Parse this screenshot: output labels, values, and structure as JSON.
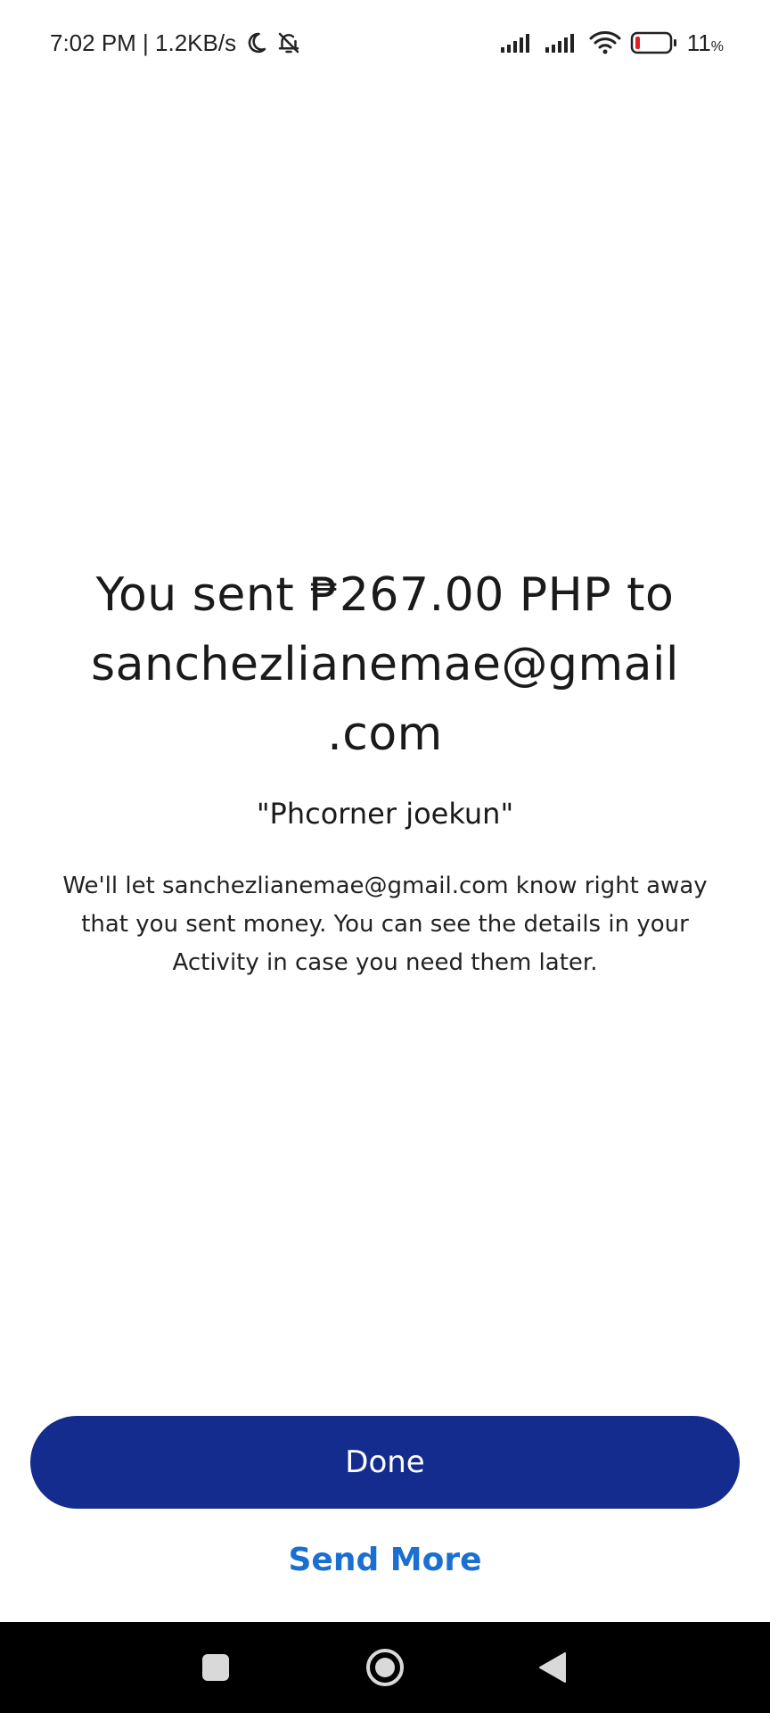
{
  "status_bar": {
    "time_speed": "7:02 PM | 1.2KB/s",
    "battery_level": "11",
    "battery_unit": "%",
    "icons": [
      "moon-icon",
      "bell-off-icon",
      "signal-icon",
      "signal-icon",
      "wifi-icon",
      "battery-icon"
    ]
  },
  "confirmation": {
    "headline_line1": "You sent ₱267.00 PHP to",
    "headline_line2": "sanchezlianemae@gmail",
    "headline_line3": ".com",
    "note": "\"Phcorner joekun\"",
    "description": "We'll let sanchezlianemae@gmail.com know right away that you sent money. You can see the details in your Activity in case you need them later."
  },
  "actions": {
    "done_label": "Done",
    "send_more_label": "Send More"
  },
  "nav_bar": {
    "icons": [
      "recents-square-icon",
      "home-circle-icon",
      "back-triangle-icon"
    ]
  },
  "colors": {
    "primary_button": "#142c8e",
    "link": "#1b6fd0",
    "nav_bar": "#000000",
    "battery_low": "#e02020"
  }
}
